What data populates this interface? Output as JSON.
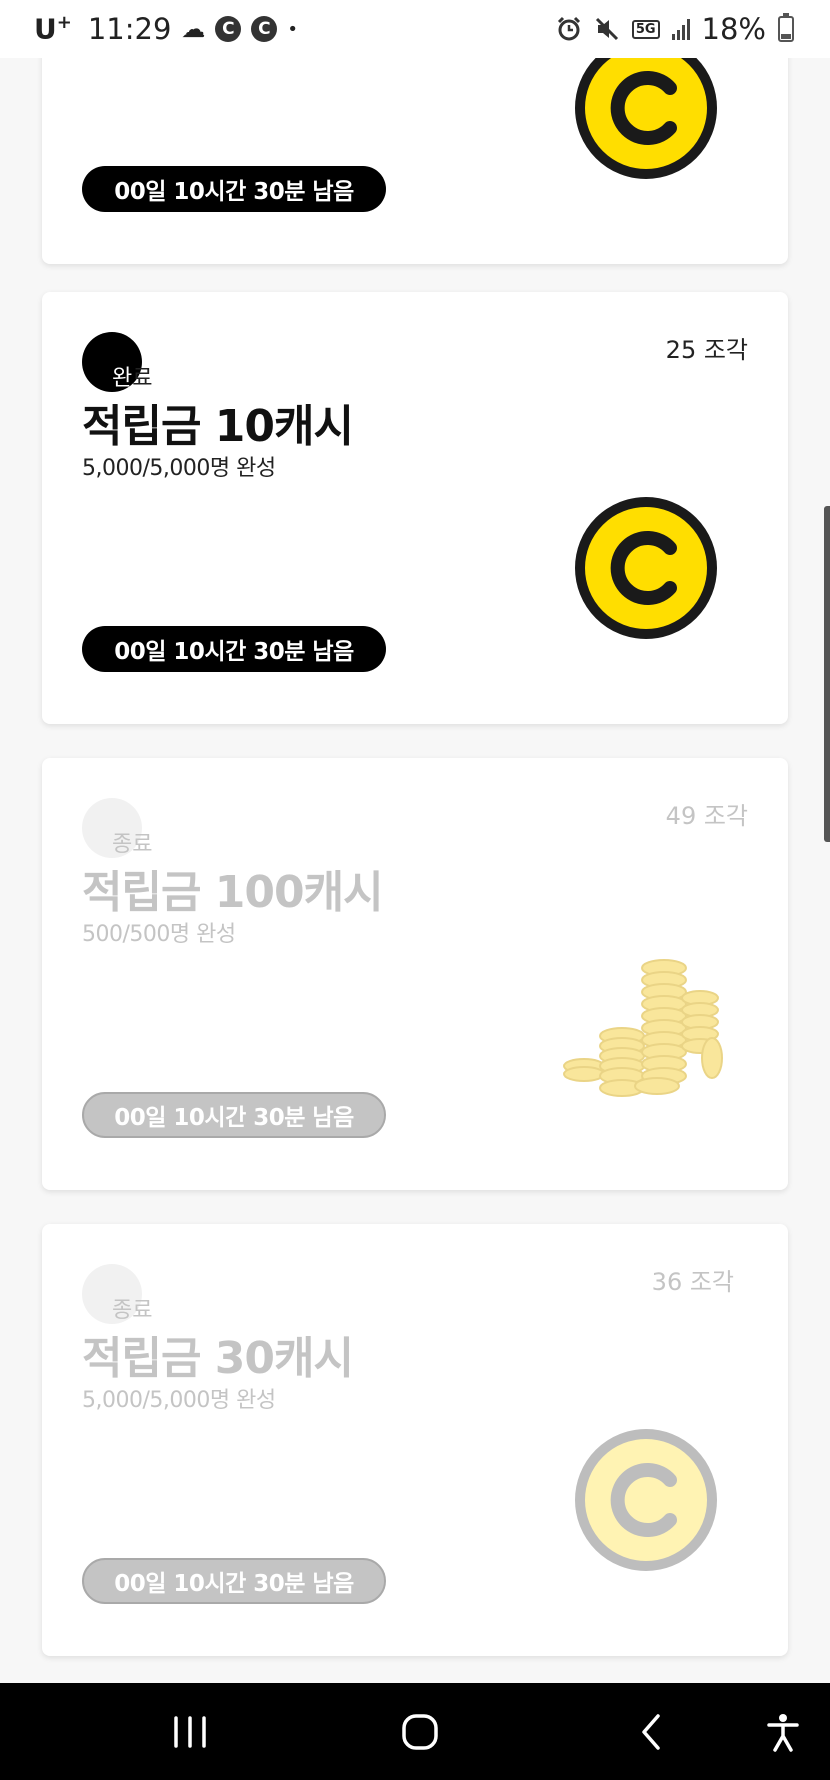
{
  "status_bar": {
    "carrier": "U",
    "carrier_sup": "+",
    "time": "11:29",
    "notification_c1": "C",
    "notification_c2": "C",
    "more_dot": "•",
    "network_badge": "5G",
    "battery_percent": "18%"
  },
  "cards": [
    {
      "state": "active",
      "timer": "00일 10시간 30분 남음",
      "reward_icon": "coin-c-icon"
    },
    {
      "state": "completed",
      "pieces": "25 조각",
      "badge": "완료",
      "title": "적립금 10캐시",
      "progress": "5,000/5,000명 완성",
      "timer": "00일 10시간 30분 남음",
      "reward_icon": "coin-c-icon"
    },
    {
      "state": "ended",
      "pieces": "49 조각",
      "badge": "종료",
      "title": "적립금 100캐시",
      "progress": "500/500명 완성",
      "timer": "00일 10시간 30분 남음",
      "reward_icon": "coin-stack-icon"
    },
    {
      "state": "ended",
      "pieces": "36 조각",
      "badge": "종료",
      "title": "적립금 30캐시",
      "progress": "5,000/5,000명 완성",
      "timer": "00일 10시간 30분 남음",
      "reward_icon": "coin-c-icon"
    }
  ],
  "colors": {
    "coin_yellow": "#ffde00",
    "coin_outline": "#1a1a1a",
    "faded_coin_yellow": "#fff3b3",
    "faded_gray": "#c4c4c4"
  },
  "nav_bar": {
    "icons": [
      "recent-apps-icon",
      "home-icon",
      "back-icon",
      "accessibility-icon"
    ]
  }
}
